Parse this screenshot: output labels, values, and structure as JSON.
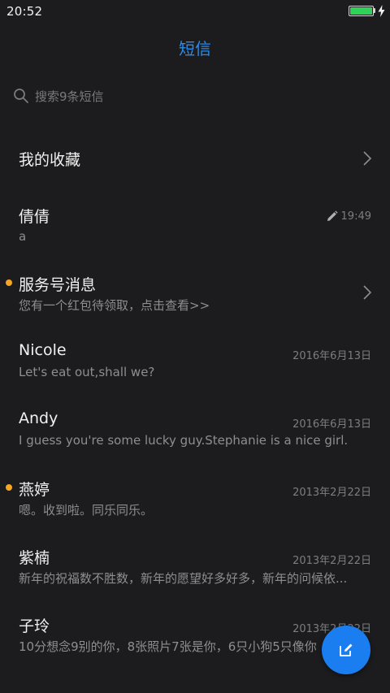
{
  "status_bar": {
    "time": "20:52",
    "battery_level": 1.0,
    "charging": true,
    "battery_color": "#2fd158"
  },
  "header": {
    "title": "短信",
    "accent_color": "#2b8be8"
  },
  "search": {
    "placeholder": "搜索9条短信",
    "icon": "search-icon"
  },
  "favorites": {
    "label": "我的收藏",
    "icon": "chevron-right-icon"
  },
  "conversations": [
    {
      "name": "倩倩",
      "snippet": "a",
      "time": "19:49",
      "draft": true,
      "unread": false
    },
    {
      "name": "服务号消息",
      "snippet": "您有一个红包待领取，点击查看>>",
      "time": "",
      "unread": true,
      "chevron": true
    },
    {
      "name": "Nicole",
      "snippet": "Let's eat out,shall we?",
      "time": "2016年6月13日",
      "unread": false
    },
    {
      "name": "Andy",
      "snippet": "I guess you're some lucky guy.Stephanie is a nice girl.",
      "time": "2016年6月13日",
      "unread": false
    },
    {
      "name": "燕婷",
      "snippet": "嗯。收到啦。同乐同乐。",
      "time": "2013年2月22日",
      "unread": true
    },
    {
      "name": "紫楠",
      "snippet": "新年的祝福数不胜数，新年的愿望好多好多，新年的问候依...",
      "time": "2013年2月22日",
      "unread": false
    },
    {
      "name": "子玲",
      "snippet": "10分想念9别的你，8张照片7张是你，6只小狗5只像你",
      "time": "2013年2月22日",
      "unread": false
    }
  ],
  "fab": {
    "icon": "compose-icon",
    "color": "#1a7df0"
  },
  "unread_dot_color": "#f5a623"
}
